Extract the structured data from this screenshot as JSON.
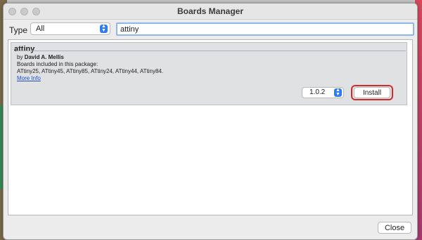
{
  "window": {
    "title": "Boards Manager"
  },
  "filter": {
    "type_label": "Type",
    "type_value": "All",
    "search_value": "attiny"
  },
  "package": {
    "name": "attiny",
    "by_prefix": "by",
    "author": "David A. Mellis",
    "boards_label": "Boards included in this package:",
    "boards_list": "ATtiny25, ATtiny45, ATtiny85, ATtiny24, ATtiny44, ATtiny84.",
    "more_info": "More Info",
    "version": "1.0.2",
    "install_label": "Install"
  },
  "footer": {
    "close_label": "Close"
  },
  "colors": {
    "highlight_ring": "#d42a2a",
    "link": "#1f4fd0",
    "accent": "#2f7bf5"
  }
}
